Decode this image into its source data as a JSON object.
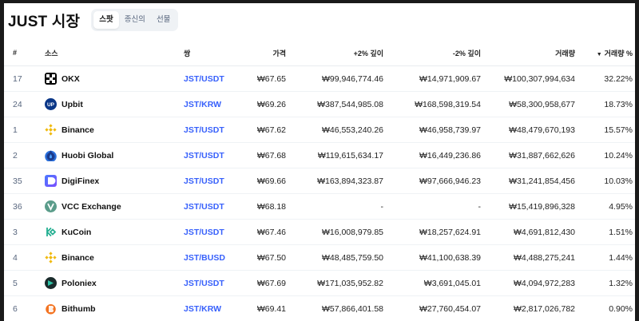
{
  "header": {
    "title": "JUST 시장",
    "tabs": [
      "스팟",
      "종신의",
      "선물"
    ]
  },
  "table": {
    "columns": {
      "num": "#",
      "exchange": "소스",
      "pair": "쌍",
      "price": "가격",
      "depth_plus": "+2% 깊이",
      "depth_minus": "-2% 깊이",
      "volume": "거래량",
      "volume_pct": "거래량 %",
      "sort_icon": "sort-desc-icon"
    },
    "rows": [
      {
        "num": "17",
        "exchange": "OKX",
        "logo": "okx-logo-icon",
        "pair": "JST/USDT",
        "price": "₩67.65",
        "depth_plus": "₩99,946,774.46",
        "depth_minus": "₩14,971,909.67",
        "volume": "₩100,307,994,634",
        "volume_pct": "32.22%"
      },
      {
        "num": "24",
        "exchange": "Upbit",
        "logo": "upbit-logo-icon",
        "pair": "JST/KRW",
        "price": "₩69.26",
        "depth_plus": "₩387,544,985.08",
        "depth_minus": "₩168,598,319.54",
        "volume": "₩58,300,958,677",
        "volume_pct": "18.73%"
      },
      {
        "num": "1",
        "exchange": "Binance",
        "logo": "binance-logo-icon",
        "pair": "JST/USDT",
        "price": "₩67.62",
        "depth_plus": "₩46,553,240.26",
        "depth_minus": "₩46,958,739.97",
        "volume": "₩48,479,670,193",
        "volume_pct": "15.57%"
      },
      {
        "num": "2",
        "exchange": "Huobi Global",
        "logo": "huobi-logo-icon",
        "pair": "JST/USDT",
        "price": "₩67.68",
        "depth_plus": "₩119,615,634.17",
        "depth_minus": "₩16,449,236.86",
        "volume": "₩31,887,662,626",
        "volume_pct": "10.24%"
      },
      {
        "num": "35",
        "exchange": "DigiFinex",
        "logo": "digifinex-logo-icon",
        "pair": "JST/USDT",
        "price": "₩69.66",
        "depth_plus": "₩163,894,323.87",
        "depth_minus": "₩97,666,946.23",
        "volume": "₩31,241,854,456",
        "volume_pct": "10.03%"
      },
      {
        "num": "36",
        "exchange": "VCC Exchange",
        "logo": "vcc-logo-icon",
        "pair": "JST/USDT",
        "price": "₩68.18",
        "depth_plus": "-",
        "depth_minus": "-",
        "volume": "₩15,419,896,328",
        "volume_pct": "4.95%"
      },
      {
        "num": "3",
        "exchange": "KuCoin",
        "logo": "kucoin-logo-icon",
        "pair": "JST/USDT",
        "price": "₩67.46",
        "depth_plus": "₩16,008,979.85",
        "depth_minus": "₩18,257,624.91",
        "volume": "₩4,691,812,430",
        "volume_pct": "1.51%"
      },
      {
        "num": "4",
        "exchange": "Binance",
        "logo": "binance-logo-icon",
        "pair": "JST/BUSD",
        "price": "₩67.50",
        "depth_plus": "₩48,485,759.50",
        "depth_minus": "₩41,100,638.39",
        "volume": "₩4,488,275,241",
        "volume_pct": "1.44%"
      },
      {
        "num": "5",
        "exchange": "Poloniex",
        "logo": "poloniex-logo-icon",
        "pair": "JST/USDT",
        "price": "₩67.69",
        "depth_plus": "₩171,035,952.82",
        "depth_minus": "₩3,691,045.01",
        "volume": "₩4,094,972,283",
        "volume_pct": "1.32%"
      },
      {
        "num": "6",
        "exchange": "Bithumb",
        "logo": "bithumb-logo-icon",
        "pair": "JST/KRW",
        "price": "₩69.41",
        "depth_plus": "₩57,866,401.58",
        "depth_minus": "₩27,760,454.07",
        "volume": "₩2,817,026,782",
        "volume_pct": "0.90%"
      }
    ]
  },
  "colors": {
    "accent": "#3861fb",
    "text": "#222222",
    "muted": "#58667e",
    "border": "#eff2f5",
    "background": "#ffffff",
    "outer": "#1a1a1a"
  }
}
